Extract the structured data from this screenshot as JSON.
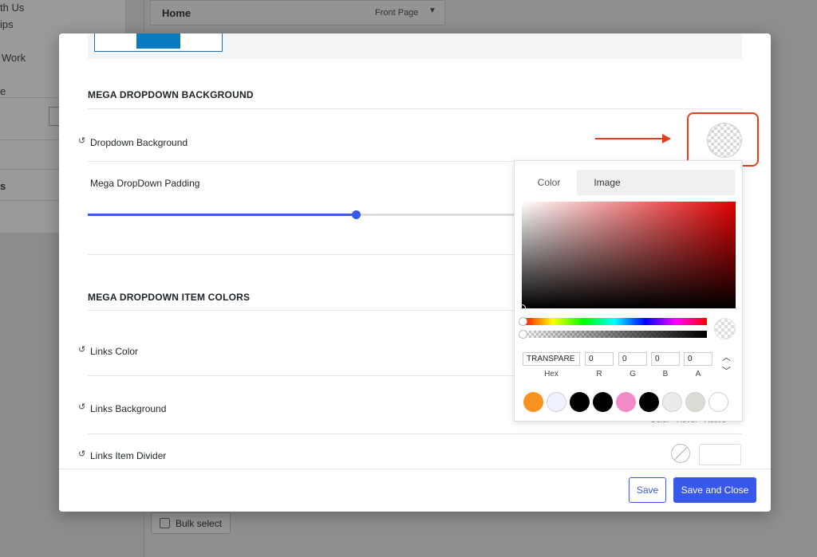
{
  "background": {
    "sidebar_items": [
      "th Us",
      "ips",
      "Work",
      "e",
      "s"
    ],
    "home_row": {
      "title": "Home",
      "value": "Front Page"
    },
    "bulk_select_label": "Bulk select"
  },
  "modal": {
    "section1_title": "MEGA DROPDOWN BACKGROUND",
    "dropdown_background_label": "Dropdown Background",
    "padding_label": "Mega DropDown Padding",
    "padding_slider_fraction": 0.6,
    "section2_title": "MEGA DROPDOWN ITEM COLORS",
    "links_color_label": "Links Color",
    "links_background_label": "Links Background",
    "links_divider_label": "Links Item Divider",
    "color_states_label": "Color · Hover · Active",
    "save_label": "Save",
    "save_close_label": "Save and Close",
    "highlight_color": "#e2401c",
    "accent_color": "#3858e9"
  },
  "picker": {
    "tabs": [
      "Color",
      "Image"
    ],
    "hex_value": "TRANSPARE",
    "r": "0",
    "g": "0",
    "b": "0",
    "a": "0",
    "labels": {
      "hex": "Hex",
      "r": "R",
      "g": "G",
      "b": "B",
      "a": "A"
    },
    "presets": [
      "#f7931e",
      "#eef2ff",
      "#000000",
      "#000000",
      "#f28ac8",
      "#000000",
      "#ebebeb",
      "#dcdcd5",
      "#ffffff"
    ]
  }
}
